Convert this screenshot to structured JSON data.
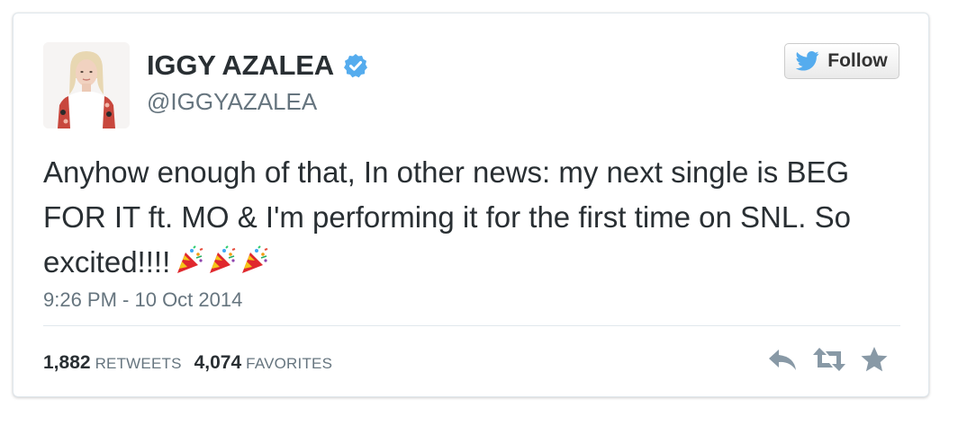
{
  "user": {
    "display_name": "IGGY AZALEA",
    "handle": "@IGGYAZALEA",
    "verified_icon": "verified-badge-icon",
    "avatar_icon": "avatar-photo"
  },
  "follow_button": {
    "label": "Follow",
    "icon": "twitter-bird-icon"
  },
  "tweet": {
    "text": "Anyhow enough of that, In other news: my next single is BEG FOR IT ft. MO & I'm performing it for the first time on SNL. So excited!!!!",
    "emojis": [
      "party-popper-icon",
      "party-popper-icon",
      "party-popper-icon"
    ],
    "timestamp": "9:26 PM - 10 Oct 2014"
  },
  "stats": {
    "retweets_count": "1,882",
    "retweets_label": "RETWEETS",
    "favorites_count": "4,074",
    "favorites_label": "FAVORITES"
  },
  "actions": {
    "reply_icon": "reply-icon",
    "retweet_icon": "retweet-icon",
    "favorite_icon": "star-icon"
  },
  "colors": {
    "verified_blue": "#55acee",
    "text_dark": "#292f33",
    "text_muted": "#66757f",
    "action_gray": "#8899a6",
    "bird_blue": "#55acee"
  }
}
